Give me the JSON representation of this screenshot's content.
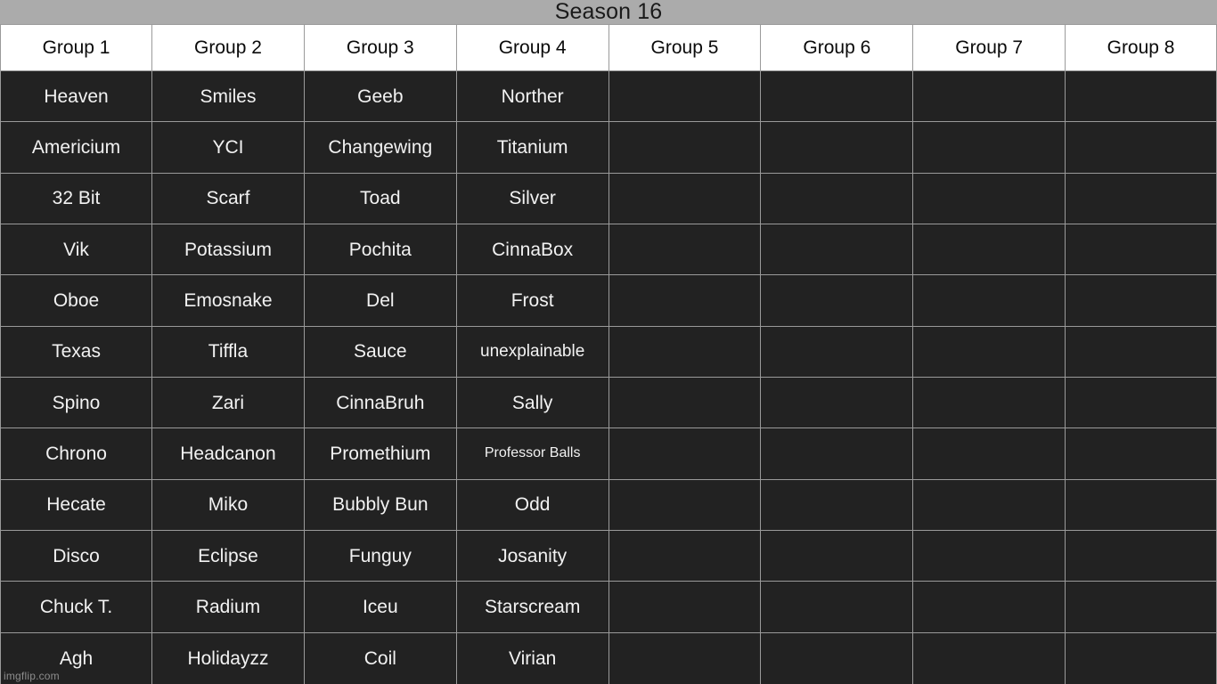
{
  "title": "Season 16",
  "colors": {
    "title_bar_bg": "#ababab",
    "title_text": "#1a1a1a",
    "header_bg": "#ffffff",
    "header_text": "#0a0a0a",
    "cell_bg": "#222222",
    "cell_text": "#f2f2f2",
    "grid_line": "#9a9a9a",
    "watermark_text": "#8d8d8d"
  },
  "watermark": "imgflip.com",
  "table": {
    "headers": [
      "Group 1",
      "Group 2",
      "Group 3",
      "Group 4",
      "Group 5",
      "Group 6",
      "Group 7",
      "Group 8"
    ],
    "rows": [
      [
        "Heaven",
        "Smiles",
        "Geeb",
        "Norther",
        "",
        "",
        "",
        ""
      ],
      [
        "Americium",
        "YCI",
        "Changewing",
        "Titanium",
        "",
        "",
        "",
        ""
      ],
      [
        "32 Bit",
        "Scarf",
        "Toad",
        "Silver",
        "",
        "",
        "",
        ""
      ],
      [
        "Vik",
        "Potassium",
        "Pochita",
        "CinnaBox",
        "",
        "",
        "",
        ""
      ],
      [
        "Oboe",
        "Emosnake",
        "Del",
        "Frost",
        "",
        "",
        "",
        ""
      ],
      [
        "Texas",
        "Tiffla",
        "Sauce",
        "unexplainable",
        "",
        "",
        "",
        ""
      ],
      [
        "Spino",
        "Zari",
        "CinnaBruh",
        "Sally",
        "",
        "",
        "",
        ""
      ],
      [
        "Chrono",
        "Headcanon",
        "Promethium",
        "Professor Balls",
        "",
        "",
        "",
        ""
      ],
      [
        "Hecate",
        "Miko",
        "Bubbly Bun",
        "Odd",
        "",
        "",
        "",
        ""
      ],
      [
        "Disco",
        "Eclipse",
        "Funguy",
        "Josanity",
        "",
        "",
        "",
        ""
      ],
      [
        "Chuck T.",
        "Radium",
        "Iceu",
        "Starscream",
        "",
        "",
        "",
        ""
      ],
      [
        "Agh",
        "Holidayzz",
        "Coil",
        "Virian",
        "",
        "",
        "",
        ""
      ]
    ]
  }
}
